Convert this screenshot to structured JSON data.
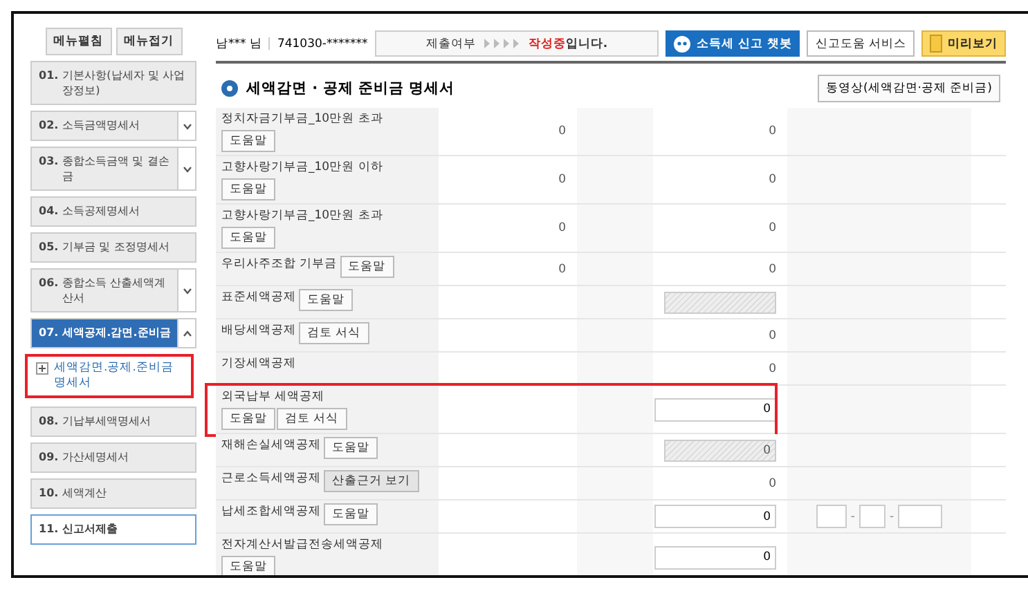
{
  "sidebar": {
    "buttons": [
      "메뉴펼침",
      "메뉴접기"
    ],
    "items": [
      {
        "number": "01.",
        "label": "기본사항(납세자 및 사업장정보)",
        "selected": false,
        "highlighted": false
      },
      {
        "number": "02.",
        "label": "소득금액명세서",
        "selected": false,
        "expanded": false,
        "highlighted": false
      },
      {
        "number": "03.",
        "label": "종합소득금액 및 결손금",
        "selected": false,
        "expanded": false,
        "highlighted": false
      },
      {
        "number": "04.",
        "label": "소득공제명세서",
        "selected": false,
        "highlighted": false
      },
      {
        "number": "05.",
        "label": "기부금 및 조정명세서",
        "selected": false,
        "highlighted": false
      },
      {
        "number": "06.",
        "label": "종합소득 산출세액계산서",
        "selected": false,
        "expanded": false,
        "highlighted": false
      },
      {
        "number": "07.",
        "label": "세액공제.감면.준비금",
        "selected": true,
        "expanded": true,
        "highlighted": false,
        "children": [
          {
            "label": "세액감면.공제.준비금 명세서",
            "highlighted": true
          }
        ]
      },
      {
        "number": "08.",
        "label": "기납부세액명세서",
        "selected": false,
        "highlighted": false
      },
      {
        "number": "09.",
        "label": "가산세명세서",
        "selected": false,
        "highlighted": false
      },
      {
        "number": "10.",
        "label": "세액계산",
        "selected": false,
        "highlighted": false
      },
      {
        "number": "11.",
        "label": "신고서제출",
        "selected": false,
        "highlighted": true
      }
    ]
  },
  "header": {
    "user": "남*** 님",
    "id_number": "741030-*******",
    "status_label": "제출여부",
    "status_value": "작성중",
    "status_suffix": "입니다.",
    "buttons": [
      {
        "label": "소득세 신고 챗봇",
        "kind": "chatbot"
      },
      {
        "label": "신고도움 서비스",
        "kind": "plain"
      },
      {
        "label": "미리보기",
        "kind": "preview"
      }
    ]
  },
  "page_title": "세액감면 · 공제 준비금 명세서",
  "video_button": "동영상(세액감면·공제 준비금)",
  "rows": [
    {
      "label": "정치자금기부금_10만원 초과",
      "stacked": true,
      "buttons": [
        {
          "label": "도움말",
          "kind": "plain"
        }
      ],
      "column_2": {
        "kind": "text",
        "value": "0"
      },
      "column_4": {
        "kind": "text",
        "value": "0"
      },
      "highlighted": false
    },
    {
      "label": "고향사랑기부금_10만원 이하",
      "stacked": true,
      "buttons": [
        {
          "label": "도움말",
          "kind": "plain"
        }
      ],
      "column_2": {
        "kind": "text",
        "value": "0"
      },
      "column_4": {
        "kind": "text",
        "value": "0"
      },
      "highlighted": false
    },
    {
      "label": "고향사랑기부금_10만원 초과",
      "stacked": true,
      "buttons": [
        {
          "label": "도움말",
          "kind": "plain"
        }
      ],
      "column_2": {
        "kind": "text",
        "value": "0"
      },
      "column_4": {
        "kind": "text",
        "value": "0"
      },
      "highlighted": false
    },
    {
      "label": "우리사주조합 기부금",
      "stacked": false,
      "buttons": [
        {
          "label": "도움말",
          "kind": "plain"
        }
      ],
      "column_2": {
        "kind": "text",
        "value": "0"
      },
      "column_4": {
        "kind": "text",
        "value": "0"
      },
      "highlighted": false
    },
    {
      "label": "표준세액공제",
      "stacked": false,
      "buttons": [
        {
          "label": "도움말",
          "kind": "plain"
        }
      ],
      "column_4": {
        "kind": "disabled"
      },
      "highlighted": false
    },
    {
      "label": "배당세액공제",
      "stacked": false,
      "buttons": [
        {
          "label": "검토 서식",
          "kind": "plain"
        }
      ],
      "column_4": {
        "kind": "text",
        "value": "0"
      },
      "highlighted": false
    },
    {
      "label": "기장세액공제",
      "stacked": false,
      "buttons": [],
      "column_4": {
        "kind": "text",
        "value": "0"
      },
      "highlighted": false
    },
    {
      "label": "외국납부 세액공제",
      "stacked": true,
      "buttons": [
        {
          "label": "도움말",
          "kind": "plain"
        },
        {
          "label": "검토 서식",
          "kind": "plain"
        }
      ],
      "column_4": {
        "kind": "input",
        "value": "0"
      },
      "highlighted": true
    },
    {
      "label": "재해손실세액공제",
      "stacked": false,
      "buttons": [
        {
          "label": "도움말",
          "kind": "plain"
        }
      ],
      "column_4": {
        "kind": "disabled",
        "value": "0"
      },
      "highlighted": false
    },
    {
      "label": "근로소득세액공제",
      "stacked": false,
      "buttons": [
        {
          "label": "산출근거 보기",
          "kind": "grey"
        }
      ],
      "column_4": {
        "kind": "text",
        "value": "0"
      },
      "highlighted": false
    },
    {
      "label": "납세조합세액공제",
      "stacked": false,
      "buttons": [
        {
          "label": "도움말",
          "kind": "plain"
        }
      ],
      "column_4": {
        "kind": "input",
        "value": "0"
      },
      "column_5": {
        "kind": "triple_input",
        "separators": [
          "-",
          "-"
        ]
      },
      "highlighted": false
    },
    {
      "label": "전자계산서발급전송세액공제",
      "stacked": true,
      "buttons": [
        {
          "label": "도움말",
          "kind": "plain"
        }
      ],
      "column_4": {
        "kind": "input",
        "value": "0"
      },
      "highlighted": false
    }
  ]
}
